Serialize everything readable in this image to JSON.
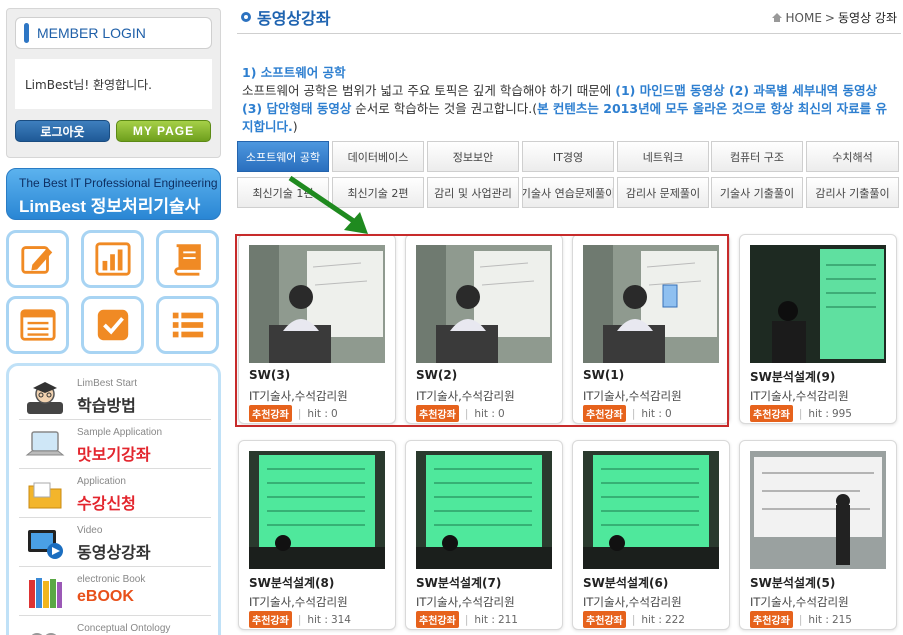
{
  "sidebar": {
    "login_title": "MEMBER LOGIN",
    "welcome": "LimBest님! 환영합니다.",
    "logout_label": "로그아웃",
    "mypage_label": "MY PAGE",
    "banner_line1": "The Best IT Professional Engineering",
    "banner_line2": "LimBest 정보처리기술사",
    "icons": [
      "edit-icon",
      "bar-chart-icon",
      "book-icon",
      "list-window-icon",
      "checkbox-icon",
      "bullet-list-icon"
    ],
    "menu": [
      {
        "sub": "LimBest Start",
        "label": "학습방법",
        "color": "#222222",
        "icon": "student-icon"
      },
      {
        "sub": "Sample Application",
        "label": "맛보기강좌",
        "color": "#e3262e",
        "icon": "laptop-icon"
      },
      {
        "sub": "Application",
        "label": "수강신청",
        "color": "#e3262e",
        "icon": "folder-icon"
      },
      {
        "sub": "Video",
        "label": "동영상강좌",
        "color": "#222222",
        "icon": "video-icon"
      },
      {
        "sub": "electronic Book",
        "label": "eBOOK",
        "color": "#e8501a",
        "icon": "books-icon"
      },
      {
        "sub": "Conceptual Ontology",
        "label": "",
        "color": "#222222",
        "icon": "ontology-icon"
      }
    ]
  },
  "header": {
    "title": "동영상강좌",
    "breadcrumb_home": "HOME",
    "breadcrumb_sep": ">",
    "breadcrumb_current": "동영상 강좌"
  },
  "intro": {
    "heading": "1) 소프트웨어 공학",
    "text1": "소프트웨어 공학은 범위가 넓고 주요 토픽은 깊게 학습해야 하기 때문에 ",
    "highlight1": "(1) 마인드맵 동영상 (2) 과목별 세부내역 동영상 (3) 답안형태 동영상",
    "text2": " 순서로 학습하는 것을 권고합니다.(",
    "highlight2": "본 컨텐츠는 2013년에 모두 올라온 것으로 항상 최신의 자료를 유지합니다.",
    "text3": ")"
  },
  "tabs": [
    {
      "label": "소프트웨어 공학",
      "active": true
    },
    {
      "label": "데이터베이스",
      "active": false
    },
    {
      "label": "정보보안",
      "active": false
    },
    {
      "label": "IT경영",
      "active": false
    },
    {
      "label": "네트워크",
      "active": false
    },
    {
      "label": "컴퓨터 구조",
      "active": false
    },
    {
      "label": "수치해석",
      "active": false
    },
    {
      "label": "최신기술 1편",
      "active": false
    },
    {
      "label": "최신기술 2편",
      "active": false
    },
    {
      "label": "감리 및 사업관리",
      "active": false
    },
    {
      "label": "기술사 연습문제풀이",
      "active": false
    },
    {
      "label": "감리사 문제풀이",
      "active": false
    },
    {
      "label": "기술사 기출풀이",
      "active": false
    },
    {
      "label": "감리사 기출풀이",
      "active": false
    }
  ],
  "cards": [
    {
      "title": "SW(3)",
      "author": "IT기술사,수석감리원",
      "badge": "추천강좌",
      "hit_label": "hit :",
      "hit": "0",
      "thumb": "lecture"
    },
    {
      "title": "SW(2)",
      "author": "IT기술사,수석감리원",
      "badge": "추천강좌",
      "hit_label": "hit :",
      "hit": "0",
      "thumb": "lecture"
    },
    {
      "title": "SW(1)",
      "author": "IT기술사,수석감리원",
      "badge": "추천강좌",
      "hit_label": "hit :",
      "hit": "0",
      "thumb": "lecture-paper"
    },
    {
      "title": "SW분석설계(9)",
      "author": "IT기술사,수석감리원",
      "badge": "추천강좌",
      "hit_label": "hit :",
      "hit": "995",
      "thumb": "screen-dark"
    },
    {
      "title": "SW분석설계(8)",
      "author": "IT기술사,수석감리원",
      "badge": "추천강좌",
      "hit_label": "hit :",
      "hit": "314",
      "thumb": "screen-green"
    },
    {
      "title": "SW분석설계(7)",
      "author": "IT기술사,수석감리원",
      "badge": "추천강좌",
      "hit_label": "hit :",
      "hit": "211",
      "thumb": "screen-green"
    },
    {
      "title": "SW분석설계(6)",
      "author": "IT기술사,수석감리원",
      "badge": "추천강좌",
      "hit_label": "hit :",
      "hit": "222",
      "thumb": "screen-green"
    },
    {
      "title": "SW분석설계(5)",
      "author": "IT기술사,수석감리원",
      "badge": "추천강좌",
      "hit_label": "hit :",
      "hit": "215",
      "thumb": "whiteboard"
    }
  ],
  "colors": {
    "accent_blue": "#1e63b0",
    "highlight_border": "#c72b2b",
    "arrow": "#1f8a1f",
    "badge": "#e6621c"
  }
}
